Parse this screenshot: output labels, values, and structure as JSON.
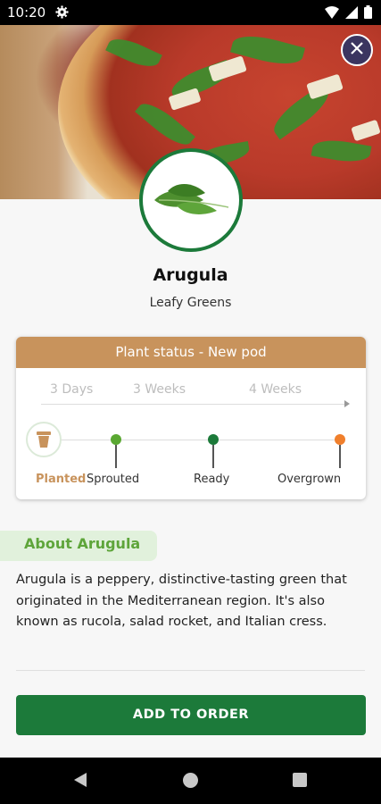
{
  "status_bar": {
    "time": "10:20",
    "icons": [
      "gear-icon",
      "wifi-icon",
      "signal-icon",
      "battery-icon"
    ]
  },
  "hero": {
    "image": "pizza-with-arugula-photo"
  },
  "plant": {
    "name": "Arugula",
    "category": "Leafy Greens",
    "avatar": "arugula-leaves-image"
  },
  "status_card": {
    "header": "Plant status - New pod",
    "durations": [
      "3 Days",
      "3 Weeks",
      "4 Weeks"
    ],
    "stages": [
      {
        "label": "Planted",
        "color": "#c8935c",
        "active": true
      },
      {
        "label": "Sprouted",
        "color": "#5aa832"
      },
      {
        "label": "Ready",
        "color": "#1c7a3a"
      },
      {
        "label": "Overgrown",
        "color": "#f07f2c"
      }
    ]
  },
  "about": {
    "title": "About Arugula",
    "text": "Arugula is a peppery, distinctive-tasting green that originated in the Mediterranean region. It's also known as rucola, salad rocket, and Italian cress."
  },
  "actions": {
    "add_to_order": "ADD TO ORDER"
  },
  "colors": {
    "brand_green": "#1c7a3a",
    "status_brown": "#c8935c",
    "about_green": "#5ea53a"
  }
}
